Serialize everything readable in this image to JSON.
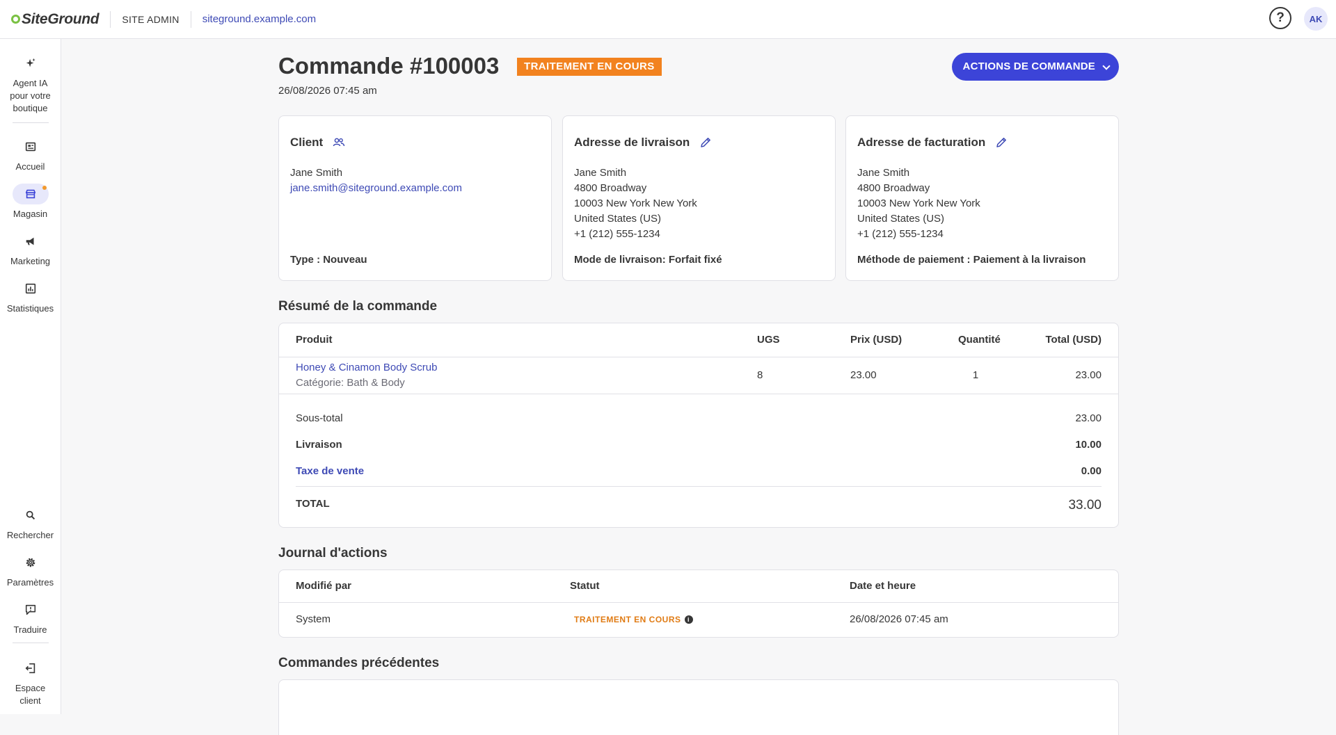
{
  "topbar": {
    "logo": "SiteGround",
    "site_admin": "SITE ADMIN",
    "site_url": "siteground.example.com",
    "help_icon": "help-circle-icon",
    "avatar_initials": "AK"
  },
  "sidebar": {
    "items": [
      {
        "label": "Agent IA pour votre boutique",
        "icon": "sparkles-icon"
      },
      {
        "label": "Accueil",
        "icon": "home-icon"
      },
      {
        "label": "Magasin",
        "icon": "store-icon",
        "active": true,
        "notification": true
      },
      {
        "label": "Marketing",
        "icon": "megaphone-icon"
      },
      {
        "label": "Statistiques",
        "icon": "chart-icon"
      },
      {
        "label": "Rechercher",
        "icon": "search-icon"
      },
      {
        "label": "Paramètres",
        "icon": "gear-icon"
      },
      {
        "label": "Traduire",
        "icon": "translate-icon"
      },
      {
        "label": "Espace client",
        "icon": "exit-icon"
      }
    ]
  },
  "order": {
    "title": "Commande #100003",
    "status": "TRAITEMENT EN COURS",
    "date": "26/08/2026 07:45 am",
    "actions_label": "ACTIONS DE COMMANDE"
  },
  "cards": {
    "client": {
      "title": "Client",
      "name": "Jane Smith",
      "email": "jane.smith@siteground.example.com",
      "footer": "Type : Nouveau"
    },
    "shipping": {
      "title": "Adresse de livraison",
      "name": "Jane Smith",
      "street": "4800 Broadway",
      "city": "10003 New York New York",
      "country": "United States (US)",
      "phone": "+1 (212) 555-1234",
      "footer": "Mode de livraison: Forfait fixé"
    },
    "billing": {
      "title": "Adresse de facturation",
      "name": "Jane Smith",
      "street": "4800 Broadway",
      "city": "10003 New York New York",
      "country": "United States (US)",
      "phone": "+1 (212) 555-1234",
      "footer": "Méthode de paiement : Paiement à la livraison"
    }
  },
  "summary": {
    "title": "Résumé de la commande",
    "headers": [
      "Produit",
      "UGS",
      "Prix (USD)",
      "Quantité",
      "Total (USD)"
    ],
    "rows": [
      {
        "product": "Honey & Cinamon Body Scrub",
        "category": "Catégorie: Bath & Body",
        "sku": "8",
        "price": "23.00",
        "qty": "1",
        "total": "23.00"
      }
    ],
    "subtotal_label": "Sous-total",
    "subtotal": "23.00",
    "shipping_label": "Livraison",
    "shipping": "10.00",
    "tax_label": "Taxe de vente",
    "tax": "0.00",
    "total_label": "TOTAL",
    "total": "33.00"
  },
  "log": {
    "title": "Journal d'actions",
    "headers": [
      "Modifié par",
      "Statut",
      "Date et heure"
    ],
    "rows": [
      {
        "by": "System",
        "status": "TRAITEMENT EN COURS",
        "datetime": "26/08/2026 07:45 am"
      }
    ]
  },
  "previous": {
    "title": "Commandes précédentes"
  },
  "colors": {
    "accent": "#3c44d8",
    "link": "#3e4ab5",
    "status_orange": "#f2821f",
    "text": "#363636"
  }
}
